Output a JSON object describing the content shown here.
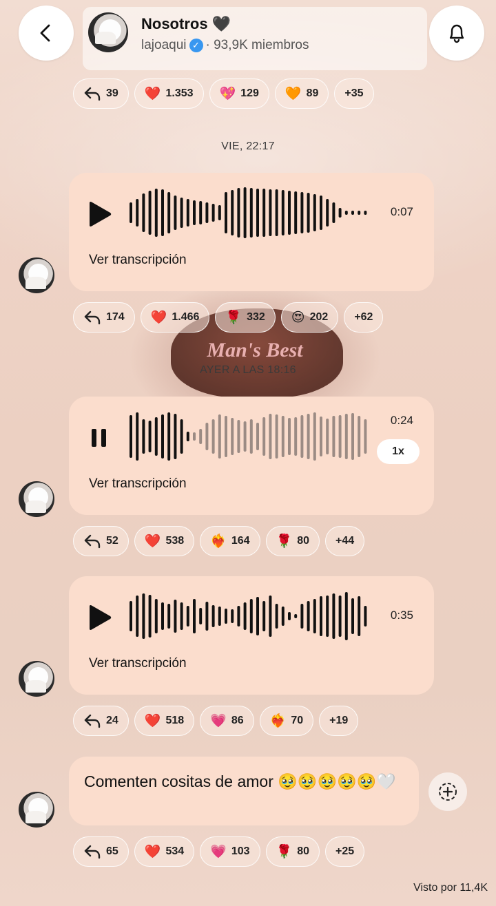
{
  "header": {
    "channel_name": "Nosotros 🖤",
    "handle": "lajoaqui",
    "members": "· 93,9K miembros"
  },
  "reaction_rows": [
    [
      {
        "emoji": "reply-icon",
        "count": "39"
      },
      {
        "emoji": "❤️",
        "count": "1.353"
      },
      {
        "emoji": "💖",
        "count": "129"
      },
      {
        "emoji": "🧡",
        "count": "89"
      },
      {
        "emoji": "",
        "count": "+35"
      }
    ],
    [
      {
        "emoji": "reply-icon",
        "count": "174"
      },
      {
        "emoji": "❤️",
        "count": "1.466"
      },
      {
        "emoji": "🌹",
        "count": "332"
      },
      {
        "emoji": "😍",
        "count": "202"
      },
      {
        "emoji": "",
        "count": "+62"
      }
    ],
    [
      {
        "emoji": "reply-icon",
        "count": "52"
      },
      {
        "emoji": "❤️",
        "count": "538"
      },
      {
        "emoji": "❤️‍🔥",
        "count": "164"
      },
      {
        "emoji": "🌹",
        "count": "80"
      },
      {
        "emoji": "",
        "count": "+44"
      }
    ],
    [
      {
        "emoji": "reply-icon",
        "count": "24"
      },
      {
        "emoji": "❤️",
        "count": "518"
      },
      {
        "emoji": "💗",
        "count": "86"
      },
      {
        "emoji": "❤️‍🔥",
        "count": "70"
      },
      {
        "emoji": "",
        "count": "+19"
      }
    ],
    [
      {
        "emoji": "reply-icon",
        "count": "65"
      },
      {
        "emoji": "❤️",
        "count": "534"
      },
      {
        "emoji": "💗",
        "count": "103"
      },
      {
        "emoji": "🌹",
        "count": "80"
      },
      {
        "emoji": "",
        "count": "+25"
      }
    ]
  ],
  "timestamps": {
    "first": "VIE, 22:17",
    "second": "AYER A LAS 18:16"
  },
  "voice_notes": [
    {
      "state": "paused",
      "duration": "0:07",
      "transcript_label": "Ver transcripción",
      "progress": 0
    },
    {
      "state": "playing",
      "duration": "0:24",
      "speed": "1x",
      "transcript_label": "Ver transcripción",
      "progress": 0.24
    },
    {
      "state": "paused",
      "duration": "0:35",
      "transcript_label": "Ver transcripción",
      "progress": 0
    }
  ],
  "text_message": "Comenten cositas de amor 🥹🥹🥹🥹🥹🤍",
  "seen_by": "Visto por 11,4K",
  "colors": {
    "bubble": "#fbddcd",
    "verified": "#3897f0"
  },
  "background_decoration_text": "Man's Best"
}
